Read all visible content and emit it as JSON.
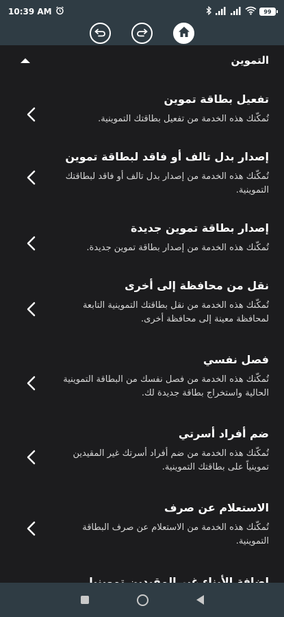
{
  "status_bar": {
    "time": "10:39 AM",
    "battery": "99"
  },
  "section": {
    "title": "التموين"
  },
  "items": [
    {
      "title": "تفعيل بطاقة تموين",
      "description": "تُمكّنك هذه الخدمة من تفعيل بطاقتك التموينية."
    },
    {
      "title": "إصدار بدل تالف أو فاقد لبطاقة تموين",
      "description": "تُمكّنك هذه الخدمة من إصدار بدل تالف أو فاقد لبطاقتك التموينية."
    },
    {
      "title": "إصدار بطاقة تموين جديدة",
      "description": "تُمكّنك هذه الخدمة من إصدار بطاقة تموين جديدة."
    },
    {
      "title": "نقل من محافظة إلى أخرى",
      "description": "تُمكّنك هذه الخدمة من نقل بطاقتك التموينية التابعة لمحافظة معينة إلى محافظة أخرى."
    },
    {
      "title": "فصل نفسي",
      "description": "تُمكّنك هذه الخدمة من فصل نفسك من البطاقة التموينية الحالية واستخراج بطاقة جديدة لك."
    },
    {
      "title": "ضم أفراد أسرتي",
      "description": "تُمكّنك هذه الخدمة من ضم أفراد أسرتك غير المقيدين تموينياً على بطاقتك التموينية."
    },
    {
      "title": "الاستعلام عن صرف",
      "description": "تُمكّنك هذه الخدمة من الاستعلام عن صرف البطاقة التموينية."
    },
    {
      "title": "اضافة الأبناء غير المقيدين تموينيا",
      "description": ""
    }
  ],
  "icons": {
    "alarm": "alarm-icon",
    "bluetooth": "bluetooth-icon",
    "signal": "signal-icon",
    "wifi": "wifi-icon",
    "back": "back-arrow-icon",
    "forward": "forward-arrow-icon",
    "home": "home-icon",
    "chevron": "chevron-left-icon"
  },
  "colors": {
    "header_bg": "#2f3c44",
    "content_bg": "#1c1c1e",
    "text": "#ffffff",
    "description_text": "#d6d6d6"
  }
}
